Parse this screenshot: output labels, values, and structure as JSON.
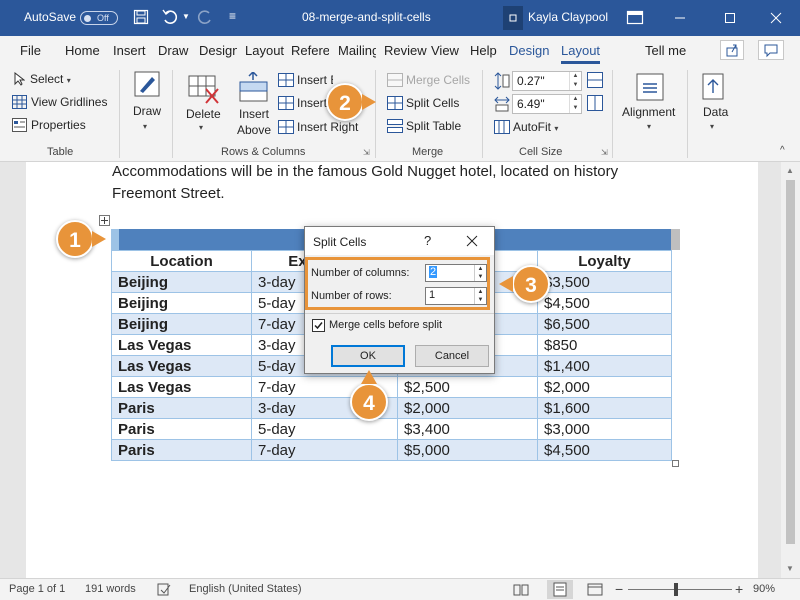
{
  "titlebar": {
    "autosave": "AutoSave",
    "autosave_state": "Off",
    "doc_name": "08-merge-and-split-cells",
    "user": "Kayla Claypool",
    "bg_color": "#2b579a"
  },
  "tabs": [
    "File",
    "Home",
    "Insert",
    "Draw",
    "Design",
    "Layout",
    "References",
    "Mailings",
    "Review",
    "View",
    "Help",
    "Design",
    "Layout"
  ],
  "tell_me": "Tell me",
  "ribbon": {
    "table": {
      "select": "Select",
      "view_gridlines": "View Gridlines",
      "properties": "Properties",
      "group": "Table"
    },
    "draw": {
      "label": "Draw"
    },
    "rows_columns": {
      "delete": "Delete",
      "insert_above_1": "Insert",
      "insert_above_2": "Above",
      "insert_below": "Insert Below",
      "insert_left": "Insert Left",
      "insert_right": "Insert Right",
      "group": "Rows & Columns"
    },
    "merge": {
      "merge_cells": "Merge Cells",
      "split_cells": "Split Cells",
      "split_table": "Split Table",
      "group": "Merge"
    },
    "cell_size": {
      "height": "0.27\"",
      "width": "6.49\"",
      "autofit": "AutoFit",
      "group": "Cell Size"
    },
    "alignment": {
      "label": "Alignment"
    },
    "data": {
      "label": "Data"
    }
  },
  "document": {
    "paragraph_line1": "Accommodations will be in the famous Gold Nugget hotel, located on history",
    "paragraph_line2": "Freemont Street.",
    "table": {
      "headers": [
        "Location",
        "Excursion",
        "",
        "Loyalty"
      ],
      "rows": [
        [
          "Beijing",
          "3-day",
          "",
          "$3,500"
        ],
        [
          "Beijing",
          "5-day",
          "",
          "$4,500"
        ],
        [
          "Beijing",
          "7-day",
          "",
          "$6,500"
        ],
        [
          "Las Vegas",
          "3-day",
          "",
          "$850"
        ],
        [
          "Las Vegas",
          "5-day",
          "",
          "$1,400"
        ],
        [
          "Las Vegas",
          "7-day",
          "$2,500",
          "$2,000"
        ],
        [
          "Paris",
          "3-day",
          "$2,000",
          "$1,600"
        ],
        [
          "Paris",
          "5-day",
          "$3,400",
          "$3,000"
        ],
        [
          "Paris",
          "7-day",
          "$5,000",
          "$4,500"
        ]
      ]
    }
  },
  "dialog": {
    "title": "Split Cells",
    "help": "?",
    "columns_label": "Number of columns:",
    "columns_value": "2",
    "rows_label": "Number of rows:",
    "rows_value": "1",
    "merge_label": "Merge cells before split",
    "merge_checked": true,
    "ok": "OK",
    "cancel": "Cancel"
  },
  "callouts": [
    "1",
    "2",
    "3",
    "4"
  ],
  "callout_color": "#e8943a",
  "status": {
    "page": "Page 1 of 1",
    "words": "191 words",
    "language": "English (United States)",
    "zoom": "90%"
  }
}
